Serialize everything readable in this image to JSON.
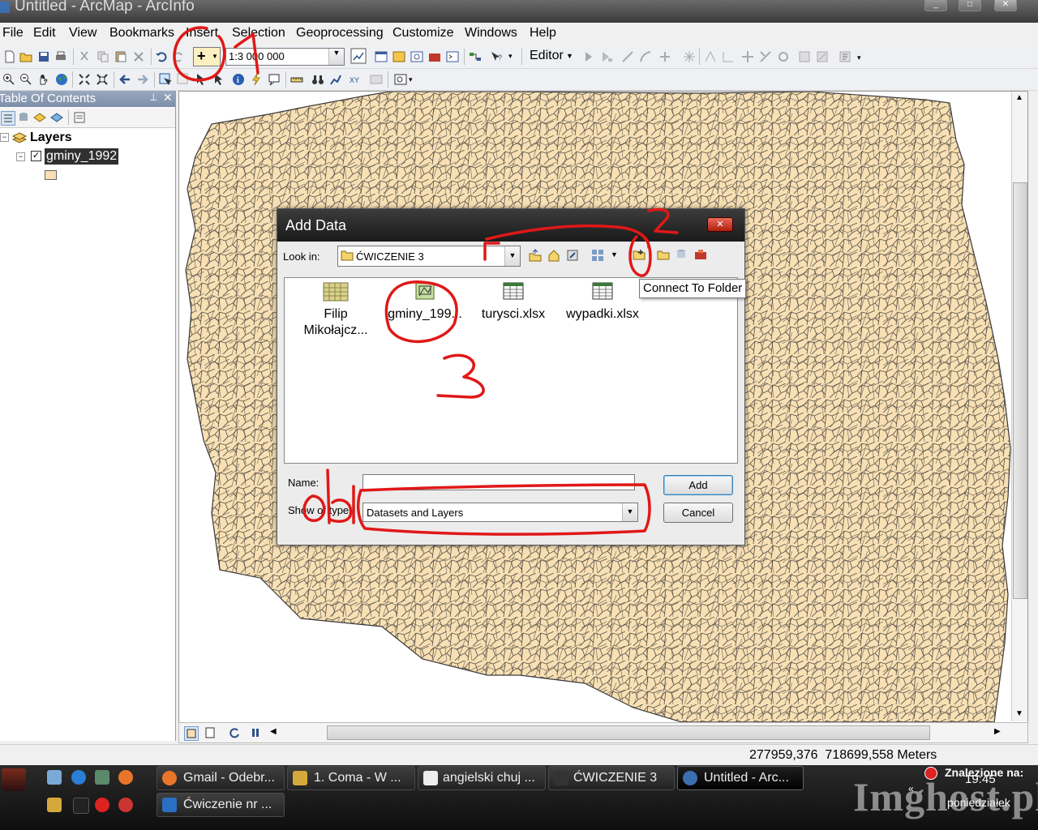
{
  "window": {
    "title": "Untitled - ArcMap - ArcInfo"
  },
  "menu": [
    "File",
    "Edit",
    "View",
    "Bookmarks",
    "Insert",
    "Selection",
    "Geoprocessing",
    "Customize",
    "Windows",
    "Help"
  ],
  "toolbar": {
    "scale_value": "1:3 000 000",
    "editor_label": "Editor"
  },
  "toc": {
    "title": "Table Of Contents",
    "root_label": "Layers",
    "layer_label": "gminy_1992",
    "layer_checked": true,
    "fill_color": "#f8e0b4"
  },
  "dialog": {
    "title": "Add Data",
    "look_in_label": "Look in:",
    "look_in_value": "ĆWICZENIE 3",
    "tooltip": "Connect To Folder",
    "items": [
      {
        "label": "Filip Mikołajcz...",
        "icon": "folder-grid-icon"
      },
      {
        "label": "gminy_199...",
        "icon": "shapefile-icon"
      },
      {
        "label": "turysci.xlsx",
        "icon": "table-icon"
      },
      {
        "label": "wypadki.xlsx",
        "icon": "table-icon"
      }
    ],
    "name_label": "Name:",
    "name_value": "",
    "type_label": "Show of type:",
    "type_value": "Datasets and Layers",
    "add_label": "Add",
    "cancel_label": "Cancel"
  },
  "annotations": {
    "marks": [
      "1",
      "2",
      "3",
      "ob"
    ],
    "color": "#e01818"
  },
  "status": {
    "coordinates": "277959,376  718699,558 Meters"
  },
  "taskbar": {
    "tasks": [
      "Gmail - Odebr...",
      "1. Coma - W ...",
      "angielski chuj ...",
      "ĆWICZENIE 3",
      "Untitled - Arc...",
      "Ćwiczenie nr ..."
    ],
    "clock_time": "19:45",
    "clock_day": "poniedziałek",
    "notice": "Znalezione na:",
    "watermark": "Imghost.pl"
  },
  "map_colors": {
    "background": "#f8e0b4",
    "border": "#3a3a3a"
  }
}
